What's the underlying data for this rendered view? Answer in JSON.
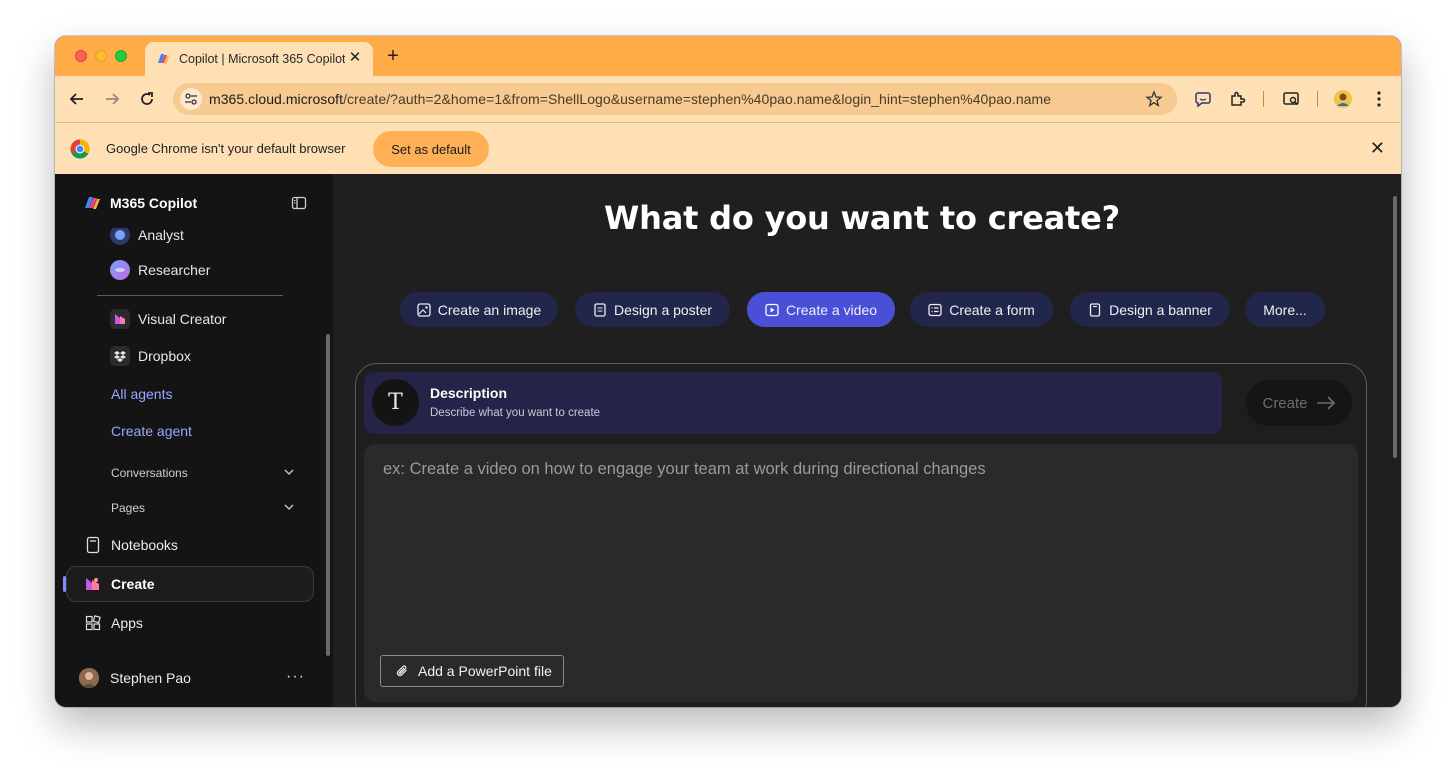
{
  "browser": {
    "tab_title": "Copilot | Microsoft 365 Copilot",
    "new_tab": "+",
    "tab_close": "✕",
    "url_host": "m365.cloud.microsoft",
    "url_path": "/create/?auth=2&home=1&from=ShellLogo&username=stephen%40pao.name&login_hint=stephen%40pao.name",
    "infobar_message": "Google Chrome isn't your default browser",
    "set_default_label": "Set as default",
    "infobar_close": "✕"
  },
  "sidebar": {
    "brand": "M365 Copilot",
    "agents": [
      {
        "label": "Analyst",
        "icon": "analyst-icon"
      },
      {
        "label": "Researcher",
        "icon": "researcher-icon"
      },
      {
        "label": "Visual Creator",
        "icon": "visual-creator-icon"
      },
      {
        "label": "Dropbox",
        "icon": "dropbox-icon"
      }
    ],
    "all_agents": "All agents",
    "create_agent": "Create agent",
    "conversations": "Conversations",
    "pages": "Pages",
    "notebooks": "Notebooks",
    "create": "Create",
    "apps": "Apps",
    "user_name": "Stephen Pao",
    "more": "···"
  },
  "main": {
    "headline": "What do you want to create?",
    "chips": [
      {
        "label": "Create an image",
        "icon": "image-icon"
      },
      {
        "label": "Design a poster",
        "icon": "poster-icon"
      },
      {
        "label": "Create a video",
        "icon": "video-icon",
        "active": true
      },
      {
        "label": "Create a form",
        "icon": "form-icon"
      },
      {
        "label": "Design a banner",
        "icon": "banner-icon"
      },
      {
        "label": "More..."
      }
    ],
    "description_title": "Description",
    "description_sub": "Describe what you want to create",
    "description_icon_letter": "T",
    "create_button": "Create",
    "placeholder": "ex: Create a video on how to engage your team at work during directional changes",
    "add_ppt": "Add a PowerPoint file"
  },
  "colors": {
    "tab_strip": "#ffab47",
    "toolbar": "#ffe0b5",
    "accent_active_chip": "#4a4fd8",
    "chip": "#22264a",
    "link": "#9aa7ff"
  }
}
